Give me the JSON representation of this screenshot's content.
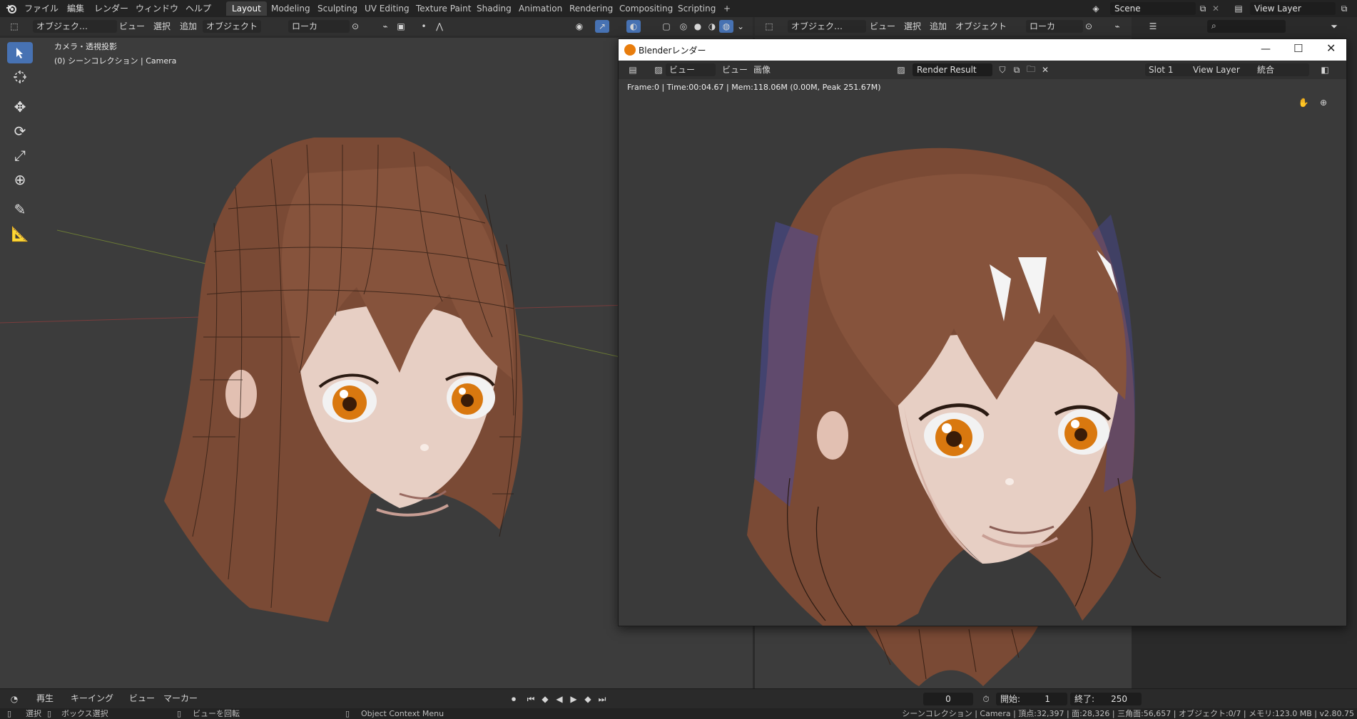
{
  "app": {
    "menu": [
      "ファイル",
      "編集",
      "レンダー",
      "ウィンドウ",
      "ヘルプ"
    ],
    "workspaces": [
      "Layout",
      "Modeling",
      "Sculpting",
      "UV Editing",
      "Texture Paint",
      "Shading",
      "Animation",
      "Rendering",
      "Compositing",
      "Scripting",
      "+"
    ],
    "active_workspace": "Layout",
    "scene_name": "Scene",
    "view_layer_name": "View Layer"
  },
  "viewport_left": {
    "mode": "オブジェク…",
    "menus": [
      "ビュー",
      "選択",
      "追加",
      "オブジェクト"
    ],
    "orientation": "ローカ",
    "overlay_title": "カメラ・透視投影",
    "overlay_subtitle": "(0) シーンコレクション | Camera"
  },
  "viewport_right": {
    "mode": "オブジェク…",
    "menus": [
      "ビュー",
      "選択",
      "追加",
      "オブジェクト"
    ],
    "orientation": "ローカ"
  },
  "render_window": {
    "title": "Blenderレンダー",
    "view_label": "ビュー",
    "menus": [
      "ビュー",
      "画像"
    ],
    "image_name": "Render Result",
    "slot": "Slot 1",
    "view_layer": "View Layer",
    "pass": "統合",
    "info": "Frame:0 | Time:00:04.67 | Mem:118.06M (0.00M, Peak 251.67M)"
  },
  "timeline": {
    "menus": [
      "再生",
      "キーイング",
      "ビュー",
      "マーカー"
    ],
    "current_frame": "0",
    "start_label": "開始:",
    "start": "1",
    "end_label": "終了:",
    "end": "250"
  },
  "statusbar": {
    "select": "選択",
    "box_select": "ボックス選択",
    "rotate_view": "ビューを回転",
    "context_menu": "Object Context Menu",
    "stats": "シーンコレクション | Camera | 頂点:32,397 | 面:28,326 | 三角面:56,657 | オブジェクト:0/7 | メモリ:123.0 MB | v2.80.75"
  },
  "colors": {
    "accent": "#4772b3",
    "hair": "#7a4a35",
    "skin": "#e7cfc4",
    "eye": "#d9780f"
  }
}
